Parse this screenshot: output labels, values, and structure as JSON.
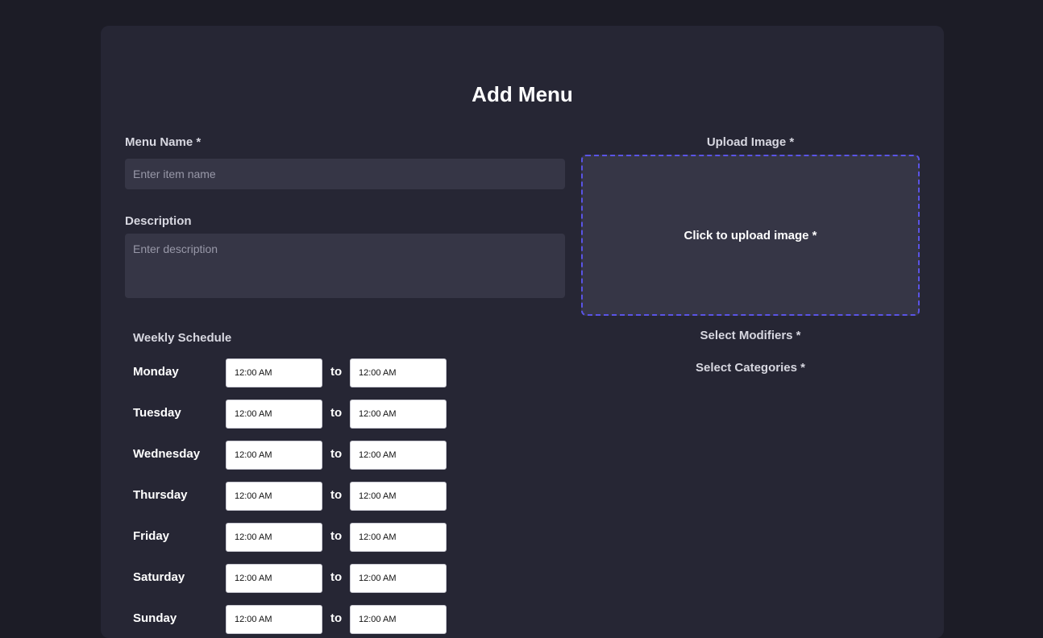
{
  "form": {
    "title": "Add Menu",
    "menu_name": {
      "label": "Menu Name *",
      "placeholder": "Enter item name",
      "value": ""
    },
    "description": {
      "label": "Description",
      "placeholder": "Enter description",
      "value": ""
    },
    "upload": {
      "label": "Upload Image *",
      "prompt": "Click to upload image *"
    },
    "modifiers_label": "Select Modifiers *",
    "categories_label": "Select Categories *"
  },
  "schedule": {
    "label": "Weekly Schedule",
    "separator": "to",
    "days": [
      {
        "day": "Monday",
        "from": "12:00 AM",
        "to": "12:00 AM"
      },
      {
        "day": "Tuesday",
        "from": "12:00 AM",
        "to": "12:00 AM"
      },
      {
        "day": "Wednesday",
        "from": "12:00 AM",
        "to": "12:00 AM"
      },
      {
        "day": "Thursday",
        "from": "12:00 AM",
        "to": "12:00 AM"
      },
      {
        "day": "Friday",
        "from": "12:00 AM",
        "to": "12:00 AM"
      },
      {
        "day": "Saturday",
        "from": "12:00 AM",
        "to": "12:00 AM"
      },
      {
        "day": "Sunday",
        "from": "12:00 AM",
        "to": "12:00 AM"
      }
    ]
  },
  "colors": {
    "page_background": "#1c1c26",
    "card_background": "#262634",
    "input_background": "#363646",
    "upload_border": "#5a54e6",
    "text_primary": "#ffffff",
    "text_label": "#d7d7e0"
  }
}
